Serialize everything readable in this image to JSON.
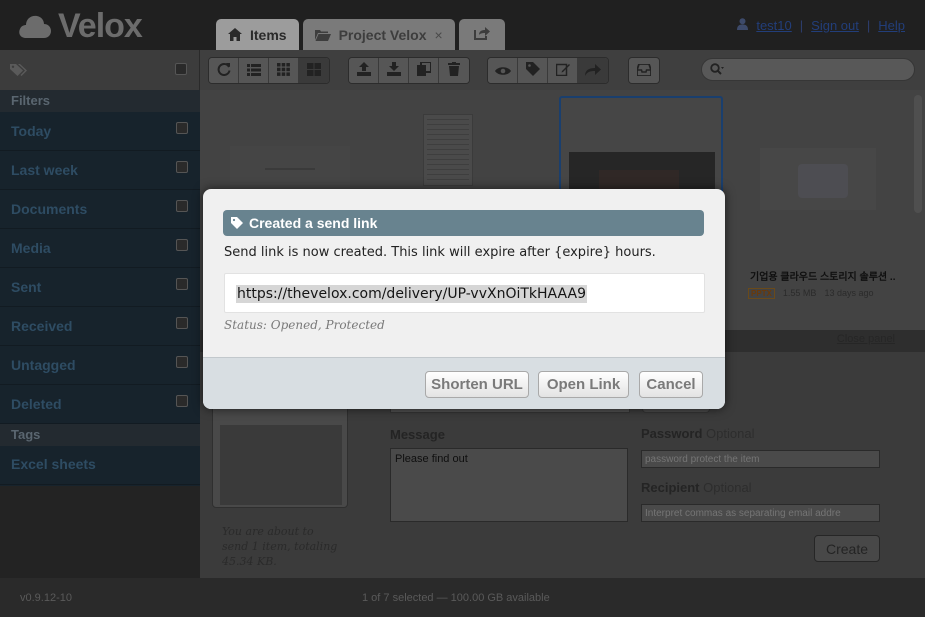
{
  "app": {
    "name": "Velox"
  },
  "tabs": [
    {
      "label": "Items",
      "active": true
    },
    {
      "label": "Project Velox",
      "closable": true,
      "close_glyph": "×"
    },
    {
      "label": "",
      "icon": "share-icon"
    }
  ],
  "user": {
    "name": "test10",
    "sign_out": "Sign out",
    "help": "Help",
    "separator": "|"
  },
  "search": {
    "placeholder": ""
  },
  "sidebar": {
    "filters_label": "Filters",
    "filters": [
      "Today",
      "Last week",
      "Documents",
      "Media",
      "Sent",
      "Received",
      "Untagged",
      "Deleted"
    ],
    "tags_label": "Tags",
    "tags": [
      "Excel sheets"
    ]
  },
  "files": [
    {
      "name": "기업용 클라우드 스토리지 솔루션 ..",
      "type": "PPTX",
      "size": "1.55 MB",
      "age": "13 days ago"
    }
  ],
  "panel": {
    "close_label": "Close panel",
    "send_note": "You are about to send 1 item, totaling 45.34 KB.",
    "message_label": "Message",
    "message_value": "Please find out",
    "password_label": "Password",
    "password_optional": "Optional",
    "password_placeholder": "password protect the item",
    "recipient_label": "Recipient",
    "recipient_optional": "Optional",
    "recipient_placeholder": "Interpret commas as separating email addre",
    "create_label": "Create"
  },
  "status": {
    "version": "v0.9.12-10",
    "summary": "1 of 7 selected — 100.00 GB available"
  },
  "modal": {
    "title": "Created a send link",
    "message": "Send link is now created. This link will expire after {expire} hours.",
    "link": "https://thevelox.com/delivery/UP-vvXnOiTkHAAA9",
    "status": "Status: Opened, Protected",
    "buttons": {
      "shorten": "Shorten URL",
      "open": "Open Link",
      "cancel": "Cancel"
    }
  },
  "colors": {
    "modal_header": "#68838f",
    "modal_footer": "#d8dee2",
    "link_highlight": "#d6d6d6"
  }
}
